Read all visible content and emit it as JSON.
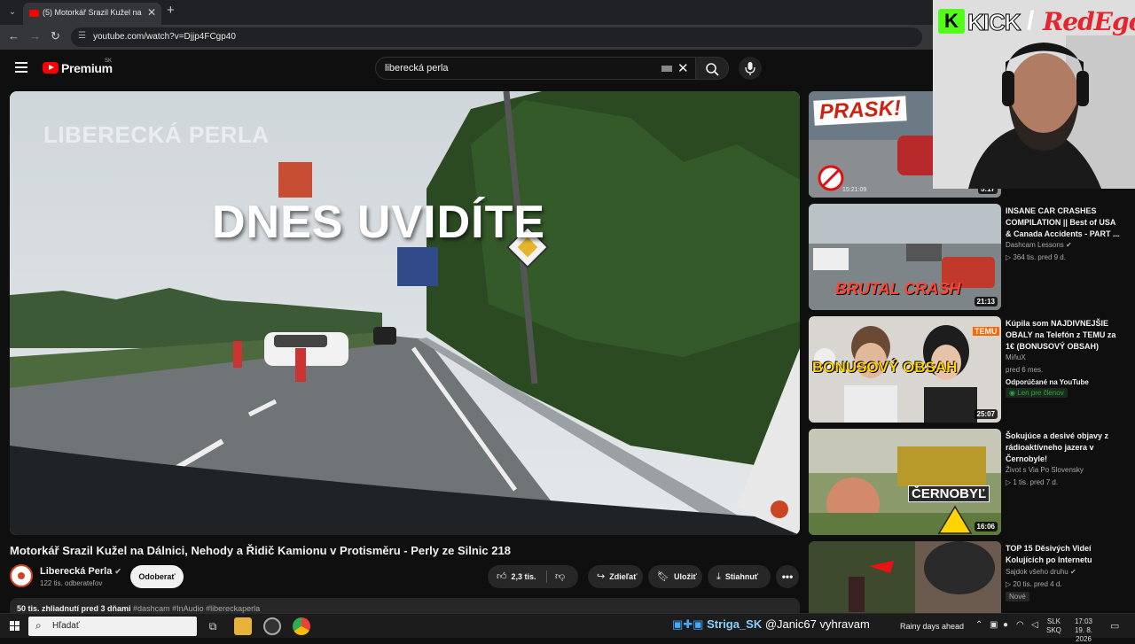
{
  "browser": {
    "tab_title": "(5) Motorkář Srazil Kužel na Dál",
    "url": "youtube.com/watch?v=Djjp4FCgp40"
  },
  "youtube": {
    "logo_text": "Premium",
    "country_code": "SK",
    "search_value": "liberecká perla"
  },
  "video": {
    "watermark": "LIBERECKÁ PERLA",
    "headline": "DNES UVIDÍTE",
    "title": "Motorkář Srazil Kužel na Dálnici, Nehody a Řidič Kamionu v Protisměru - Perly ze Silnic 218"
  },
  "owner": {
    "channel_name": "Liberecká Perla",
    "subscribers": "122 tis. odberateľov",
    "subscribe_label": "Odoberať"
  },
  "actions": {
    "likes": "2,3 tis.",
    "share": "Zdieľať",
    "save": "Uložiť",
    "download": "Stiahnuť"
  },
  "description": {
    "stats": "50 tis. zhliadnutí  pred 3 dňami",
    "tags": "#dashcam #InAudio #libereckaperla"
  },
  "recommendations": [
    {
      "thumb_text": "PRASK!",
      "duration": "5:17",
      "thumb_time": "15:21:09"
    },
    {
      "thumb_text": "BRUTAL CRASH",
      "duration": "21:13",
      "title": "INSANE CAR CRASHES COMPILATION || Best of USA & Canada Accidents - PART ...",
      "channel": "Dashcam Lessons",
      "meta": "▷ 364 tis.   pred 9 d."
    },
    {
      "thumb_text": "BONUSOVÝ OBSAH",
      "thumb_corner": "TEMU",
      "duration": "25:07",
      "title": "Kúpila som NAJDIVNEJŠIE OBALY na Telefón z TEMU za 1€ (BONUSOVÝ OBSAH)",
      "channel": "MiňuX",
      "meta": "pred 6 mes.",
      "badge": "Odporúčané na YouTube",
      "member": "Len pre členov"
    },
    {
      "thumb_text": "ČERNOBYĽ",
      "duration": "16:06",
      "title": "Šokujúce a desivé objavy z rádioaktívneho jazera v Černobyle!",
      "channel": "Život s Via Po Slovensky",
      "meta": "▷ 1 tis.   pred 7 d."
    },
    {
      "title": "TOP 15 Děsivých Videí Kolujících po Internetu",
      "channel": "Sajdok všeho druhu",
      "meta": "▷ 20 tis.   pred 4 d.",
      "new": "Nové"
    }
  ],
  "stream": {
    "logo_left": "KICK",
    "logo_right": "RedEgo"
  },
  "taskbar": {
    "search_placeholder": "Hľadať",
    "chat_user": "Striga_SK",
    "chat_text": "@Janic67 vyhravam",
    "weather": "Rainy days ahead",
    "lang_top": "SLK",
    "lang_bottom": "SKQ",
    "time": "17:03",
    "date": "19. 8. 2026"
  },
  "colors": {
    "youtube_red": "#ff0000",
    "kick_green": "#53fc18",
    "background": "#0f0f0f"
  }
}
